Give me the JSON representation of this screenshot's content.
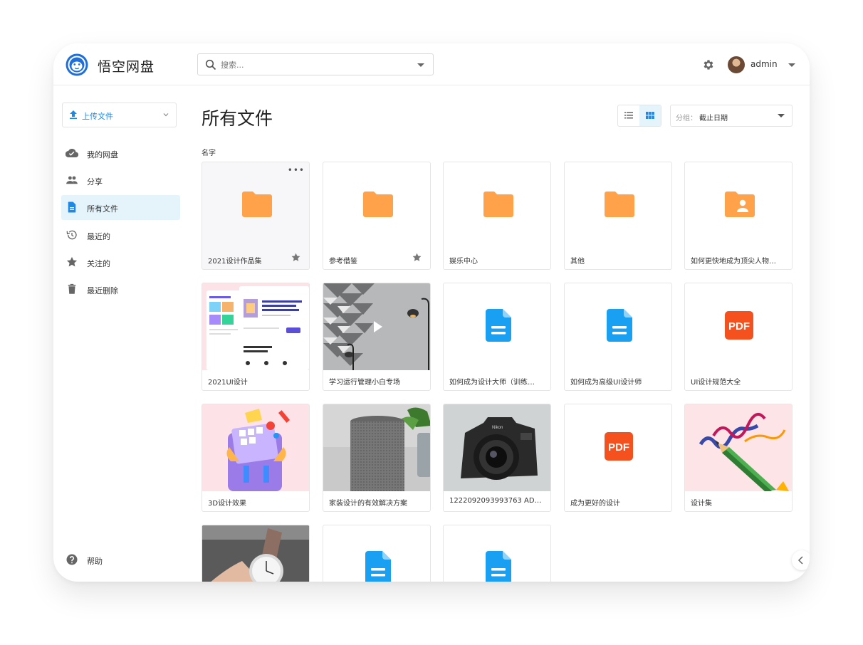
{
  "header": {
    "app_title": "悟空网盘",
    "search_placeholder": "搜索...",
    "user_name": "admin"
  },
  "sidebar": {
    "upload_label": "上传文件",
    "items": [
      {
        "label": "我的网盘",
        "icon": "cloud-icon"
      },
      {
        "label": "分享",
        "icon": "people-icon"
      },
      {
        "label": "所有文件",
        "icon": "document-icon",
        "active": true
      },
      {
        "label": "最近的",
        "icon": "history-icon"
      },
      {
        "label": "关注的",
        "icon": "star-icon"
      },
      {
        "label": "最近删除",
        "icon": "trash-icon"
      }
    ],
    "help_label": "帮助"
  },
  "main": {
    "title": "所有文件",
    "group_label": "分组：",
    "group_value": "截止日期",
    "column_header": "名字"
  },
  "files": [
    {
      "name": "2021设计作品集",
      "type": "folder",
      "starred": true
    },
    {
      "name": "参考借鉴",
      "type": "folder",
      "starred": true
    },
    {
      "name": "娱乐中心",
      "type": "folder"
    },
    {
      "name": "其他",
      "type": "folder"
    },
    {
      "name": "如何更快地成为顶尖人物…",
      "type": "shared-folder"
    },
    {
      "name": "2021UI设计",
      "type": "image-web"
    },
    {
      "name": "学习运行管理小白专场",
      "type": "video"
    },
    {
      "name": "如何成为设计大师（训练…",
      "type": "doc"
    },
    {
      "name": "如何成为高级UI设计师",
      "type": "doc"
    },
    {
      "name": "UI设计规范大全",
      "type": "pdf"
    },
    {
      "name": "3D设计效果",
      "type": "image-3d"
    },
    {
      "name": "家装设计的有效解决方案",
      "type": "image-speaker"
    },
    {
      "name": "1222092093993763 AD…",
      "type": "image-camera"
    },
    {
      "name": "成为更好的设计",
      "type": "pdf"
    },
    {
      "name": "设计集",
      "type": "image-pencil"
    },
    {
      "name": "",
      "type": "image-watch"
    },
    {
      "name": "",
      "type": "doc"
    },
    {
      "name": "",
      "type": "doc"
    }
  ],
  "colors": {
    "accent": "#1e88e5",
    "folder": "#ffa24a",
    "doc": "#1aa0f2",
    "pdf": "#f4511e",
    "active_bg": "#e5f3fb"
  }
}
